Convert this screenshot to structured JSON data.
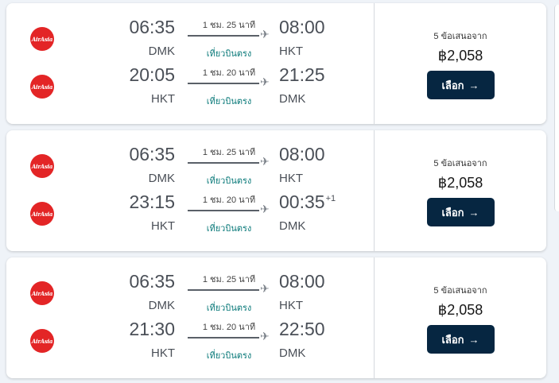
{
  "cards": [
    {
      "legs": [
        {
          "airline": "AirAsia",
          "dep_time": "06:35",
          "dep_code": "DMK",
          "duration": "1 ชม. 25 นาที",
          "stops": "เที่ยวบินตรง",
          "arr_time": "08:00",
          "arr_code": "HKT",
          "day_offset": ""
        },
        {
          "airline": "AirAsia",
          "dep_time": "20:05",
          "dep_code": "HKT",
          "duration": "1 ชม. 20 นาที",
          "stops": "เที่ยวบินตรง",
          "arr_time": "21:25",
          "arr_code": "DMK",
          "day_offset": ""
        }
      ],
      "offers": "5 ข้อเสนอจาก",
      "price": "฿2,058",
      "button": "เลือก"
    },
    {
      "legs": [
        {
          "airline": "AirAsia",
          "dep_time": "06:35",
          "dep_code": "DMK",
          "duration": "1 ชม. 25 นาที",
          "stops": "เที่ยวบินตรง",
          "arr_time": "08:00",
          "arr_code": "HKT",
          "day_offset": ""
        },
        {
          "airline": "AirAsia",
          "dep_time": "23:15",
          "dep_code": "HKT",
          "duration": "1 ชม. 20 นาที",
          "stops": "เที่ยวบินตรง",
          "arr_time": "00:35",
          "arr_code": "DMK",
          "day_offset": "+1"
        }
      ],
      "offers": "5 ข้อเสนอจาก",
      "price": "฿2,058",
      "button": "เลือก"
    },
    {
      "legs": [
        {
          "airline": "AirAsia",
          "dep_time": "06:35",
          "dep_code": "DMK",
          "duration": "1 ชม. 25 นาที",
          "stops": "เที่ยวบินตรง",
          "arr_time": "08:00",
          "arr_code": "HKT",
          "day_offset": ""
        },
        {
          "airline": "AirAsia",
          "dep_time": "21:30",
          "dep_code": "HKT",
          "duration": "1 ชม. 20 นาที",
          "stops": "เที่ยวบินตรง",
          "arr_time": "22:50",
          "arr_code": "DMK",
          "day_offset": ""
        }
      ],
      "offers": "5 ข้อเสนอจาก",
      "price": "฿2,058",
      "button": "เลือก"
    }
  ],
  "icons": {
    "plane": "plane-icon",
    "arrow": "arrow-right-icon",
    "airline_logo": "airasia-logo"
  },
  "colors": {
    "button_bg": "#062641",
    "direct_text": "#0b7a7a",
    "logo_red": "#e32526"
  }
}
